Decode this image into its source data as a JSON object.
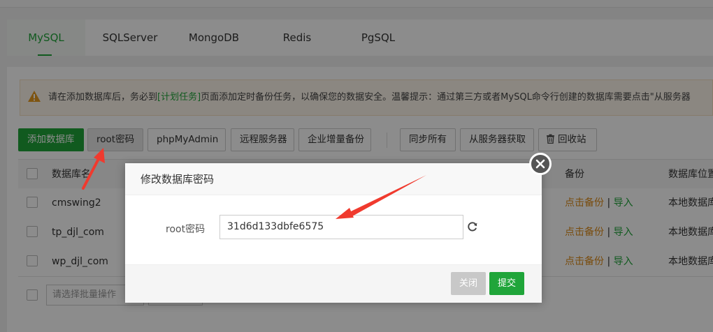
{
  "tabs": [
    "MySQL",
    "SQLServer",
    "MongoDB",
    "Redis",
    "PgSQL"
  ],
  "notice": {
    "text_before": "请在添加数据库后，务必到",
    "link": "[计划任务]",
    "text_after": "页面添加定时备份任务，以确保您的数据安全。温馨提示：通过第三方或者MySQL命令行创建的数据库需要点击\"从服务器"
  },
  "toolbar": {
    "add_db": "添加数据库",
    "root_password": "root密码",
    "phpmyadmin": "phpMyAdmin",
    "remote_server": "远程服务器",
    "enterprise_backup": "企业增量备份",
    "sync_all": "同步所有",
    "fetch_from_server": "从服务器获取",
    "recycle_bin": "回收站"
  },
  "table": {
    "headers": {
      "name": "数据库名",
      "backup": "备份",
      "location": "数据库位置"
    },
    "rows": [
      {
        "name": "cmswing2",
        "backup": "点击备份",
        "import": "导入",
        "location": "本地数据库"
      },
      {
        "name": "tp_djl_com",
        "backup": "点击备份",
        "import": "导入",
        "location": "本地数据库"
      },
      {
        "name": "wp_djl_com",
        "backup": "点击备份",
        "import": "导入",
        "location": "本地数据库"
      }
    ],
    "separator": "|"
  },
  "batch": {
    "placeholder": "请选择批量操作"
  },
  "modal": {
    "title": "修改数据库密码",
    "label": "root密码",
    "password_value": "31d6d133dbfe6575",
    "close": "关闭",
    "submit": "提交"
  },
  "colors": {
    "accent": "#20a53a",
    "link_orange": "#dd8a18",
    "annotation_red": "#f03a2e"
  }
}
